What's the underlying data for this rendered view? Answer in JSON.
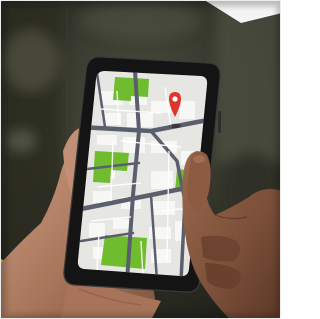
{
  "scene": {
    "description_name": "hands-holding-smartphone-with-map",
    "colors": {
      "background_dark": "#26261f",
      "background_mid": "#3d4033",
      "phone_body": "#151515",
      "map_base": "#e6e6e3",
      "map_block": "#f7f7f5",
      "road": "#5b5e6d",
      "park_green": "#6fbd2f",
      "pin_red": "#e0352b",
      "yellow_accent": "#f1c400",
      "skin_light": "#b9856a",
      "skin_dark": "#7c4f37"
    },
    "map_pin": {
      "icon": "location-pin-icon"
    }
  }
}
